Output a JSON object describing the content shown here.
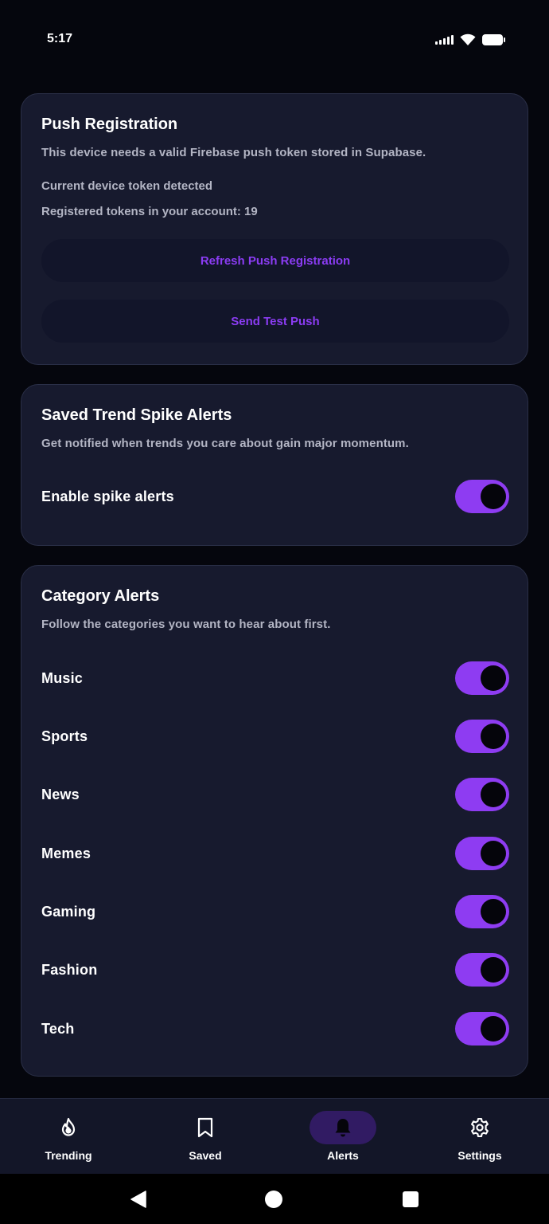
{
  "status_bar": {
    "time": "5:17"
  },
  "push_registration": {
    "title": "Push Registration",
    "description": "This device needs a valid Firebase push token stored in Supabase.",
    "token_status": "Current device token detected",
    "registered_tokens": "Registered tokens in your account: 19",
    "refresh_button": "Refresh Push Registration",
    "test_button": "Send Test Push"
  },
  "spike_alerts": {
    "title": "Saved Trend Spike Alerts",
    "description": "Get notified when trends you care about gain major momentum.",
    "toggle_label": "Enable spike alerts",
    "enabled": true
  },
  "category_alerts": {
    "title": "Category Alerts",
    "description": "Follow the categories you want to hear about first.",
    "items": [
      {
        "label": "Music",
        "enabled": true
      },
      {
        "label": "Sports",
        "enabled": true
      },
      {
        "label": "News",
        "enabled": true
      },
      {
        "label": "Memes",
        "enabled": true
      },
      {
        "label": "Gaming",
        "enabled": true
      },
      {
        "label": "Fashion",
        "enabled": true
      },
      {
        "label": "Tech",
        "enabled": true
      }
    ]
  },
  "bottom_nav": {
    "items": [
      {
        "label": "Trending",
        "icon": "flame-icon"
      },
      {
        "label": "Saved",
        "icon": "bookmark-icon"
      },
      {
        "label": "Alerts",
        "icon": "bell-icon",
        "active": true
      },
      {
        "label": "Settings",
        "icon": "gear-icon"
      }
    ]
  },
  "colors": {
    "accent": "#8e3cf2",
    "button_text": "#8b3cf3",
    "card_bg": "#171a2e",
    "page_bg": "#05060d",
    "active_nav_bg": "#311b63"
  }
}
